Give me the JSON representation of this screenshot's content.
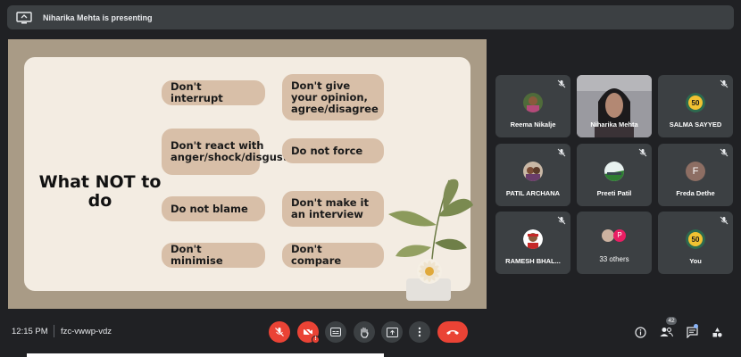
{
  "presenting": {
    "text": "Niharika Mehta is presenting"
  },
  "slide": {
    "heading": "What NOT to do",
    "items": [
      "Don't interrupt",
      "Don't give your opinion, agree/disagree",
      "Don't react with anger/shock/disgust",
      "Do not force",
      "Do not blame",
      "Don't make it an interview",
      "Don't minimise",
      "Don't compare"
    ]
  },
  "participants": [
    {
      "name": "Reema Nikalje",
      "muted": true
    },
    {
      "name": "Niharika Mehta",
      "muted": false,
      "video": true
    },
    {
      "name": "SALMA SAYYED",
      "muted": true
    },
    {
      "name": "PATIL ARCHANA",
      "muted": true
    },
    {
      "name": "Preeti Patil",
      "muted": true
    },
    {
      "name": "Freda Dethe",
      "muted": true,
      "initial": "F",
      "color": "#8d6e63"
    },
    {
      "name": "RAMESH BHAL...",
      "muted": true
    },
    {
      "name": "33 others",
      "muted": false,
      "initial": "P",
      "color": "#e91e63"
    },
    {
      "name": "You",
      "muted": true
    }
  ],
  "bottom": {
    "time": "12:15 PM",
    "meeting_code": "fzc-vwwp-vdz",
    "people_count": "42"
  },
  "icons": {
    "mic_off": "mic-off-icon",
    "camera_off": "camera-off-icon",
    "captions": "captions-icon",
    "raise_hand": "raise-hand-icon",
    "present": "present-screen-icon",
    "more": "more-options-icon",
    "hangup": "hangup-icon",
    "info": "info-icon",
    "people": "people-icon",
    "chat": "chat-icon",
    "activities": "activities-icon"
  },
  "colors": {
    "red": "#ea4335",
    "background": "#202124",
    "tile": "#3c4043",
    "pill": "#d8bfa8"
  }
}
